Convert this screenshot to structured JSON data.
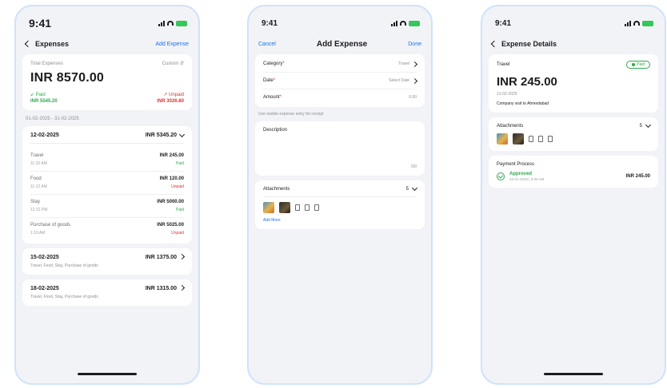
{
  "screen1": {
    "time": "9:41",
    "nav_title": "Expenses",
    "nav_action": "Add Expense",
    "summary": {
      "label": "Total Expenses",
      "filter": "Custom",
      "total": "INR 8570.00",
      "paid_label": "Paid",
      "paid_value": "INR 5545.20",
      "unpaid_label": "Unpaid",
      "unpaid_value": "INR 3026.80"
    },
    "date_range": "01-02-2025 - 31-02-2025",
    "group1": {
      "date": "12-02-2025",
      "total": "INR 5345.20",
      "items": [
        {
          "name": "Travel",
          "amount": "INR 245.00",
          "time": "11:10 AM",
          "status": "Paid",
          "status_color": "#2fa84f"
        },
        {
          "name": "Food",
          "amount": "INR 120.00",
          "time": "11:12 AM",
          "status": "Unpaid",
          "status_color": "#e03131"
        },
        {
          "name": "Stay",
          "amount": "INR 5000.00",
          "time": "12:31 PM",
          "status": "Paid",
          "status_color": "#2fa84f"
        },
        {
          "name": "Purchase of goods",
          "amount": "INR 5025.00",
          "time": "1:10 AM",
          "status": "Unpaid",
          "status_color": "#e03131"
        }
      ]
    },
    "group2": {
      "date": "15-02-2025",
      "total": "INR 1375.00",
      "sub": "Travel, Food, Stay, Purchase of goods"
    },
    "group3": {
      "date": "18-02-2025",
      "total": "INR 1315.00",
      "sub": "Travel, Food, Stay, Purchase of goods"
    }
  },
  "screen2": {
    "time": "9:41",
    "cancel": "Cancel",
    "title": "Add Expense",
    "done": "Done",
    "fields": {
      "category_label": "Category",
      "category_value": "Travel",
      "date_label": "Date",
      "date_value": "Select Date",
      "amount_label": "Amount",
      "amount_value": "0.00",
      "req_mark": "*"
    },
    "hint": "Use mobile expense entry for receipt",
    "description_label": "Description",
    "description_counter": "0/0",
    "attachments_label": "Attachments",
    "attachments_count": "5",
    "add_link": "Add More"
  },
  "screen3": {
    "time": "9:41",
    "nav_title": "Expense Details",
    "category": "Travel",
    "badge": "Paid",
    "amount": "INR 245.00",
    "date": "21-02-2025",
    "description": "Company visit to Ahmedabad",
    "attachments_label": "Attachments",
    "attachments_count": "5",
    "process_title": "Payment Process",
    "process_step": "Approved",
    "process_date": "22-01-2025 | 9:00 AM",
    "process_amount": "INR 245.00"
  },
  "colors": {
    "accent": "#1a73e8",
    "paid": "#2fa84f",
    "unpaid": "#e03131",
    "frame": "#cfe2fb"
  }
}
